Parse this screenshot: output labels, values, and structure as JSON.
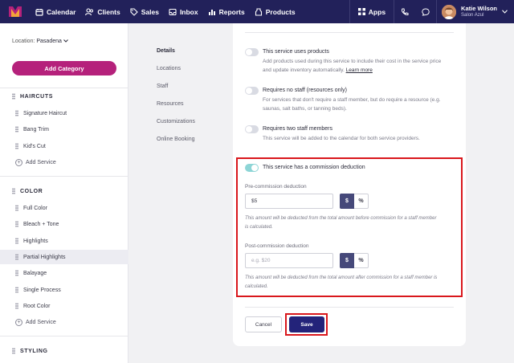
{
  "topbar": {
    "nav": [
      {
        "label": "Calendar",
        "icon": "calendar-icon"
      },
      {
        "label": "Clients",
        "icon": "clients-icon"
      },
      {
        "label": "Sales",
        "icon": "sales-tag-icon"
      },
      {
        "label": "Inbox",
        "icon": "inbox-icon"
      },
      {
        "label": "Reports",
        "icon": "reports-icon"
      },
      {
        "label": "Products",
        "icon": "products-icon"
      }
    ],
    "apps_label": "Apps",
    "user": {
      "name": "Katie Wilson",
      "org": "Salon Azul"
    }
  },
  "sidebar": {
    "location_label": "Location:",
    "location_value": "Pasadena",
    "add_category": "Add Category",
    "categories": [
      {
        "name": "HAIRCUTS",
        "services": [
          "Signature Haircut",
          "Bang Trim",
          "Kid's Cut"
        ],
        "add_label": "Add Service"
      },
      {
        "name": "COLOR",
        "services": [
          "Full Color",
          "Bleach + Tone",
          "Highlights",
          "Partial Highlights",
          "Balayage",
          "Single Process",
          "Root Color"
        ],
        "add_label": "Add Service",
        "active_service": "Partial Highlights"
      },
      {
        "name": "STYLING"
      }
    ]
  },
  "subnav": [
    "Details",
    "Locations",
    "Staff",
    "Resources",
    "Customizations",
    "Online Booking"
  ],
  "form": {
    "options": [
      {
        "title": "This service uses products",
        "desc": "Add products used during this service to include their cost in the service price and update inventory automatically.",
        "link": "Learn more",
        "on": false
      },
      {
        "title": "Requires no staff (resources only)",
        "desc": "For services that don't require a staff member, but do require a resource (e.g. saunas, salt baths, or tanning beds).",
        "on": false
      },
      {
        "title": "Requires two staff members",
        "desc": "This service will be added to the calendar for both service providers.",
        "on": false
      },
      {
        "title": "This service has a commission deduction",
        "on": true
      }
    ],
    "pre": {
      "label": "Pre-commission deduction",
      "value": "$5",
      "hint": "This amount will be deducted from the total amount before commission for a staff member is calculated."
    },
    "post": {
      "label": "Post-commission deduction",
      "placeholder": "e.g. $20",
      "hint": "This amount will be deducted from the total amount after commission for a staff member is calculated."
    },
    "unit_dollar": "$",
    "unit_percent": "%",
    "cancel": "Cancel",
    "save": "Save"
  },
  "colors": {
    "topbar": "#22215a",
    "accent": "#b5217b",
    "save": "#23237a",
    "highlight": "#d9171c"
  }
}
